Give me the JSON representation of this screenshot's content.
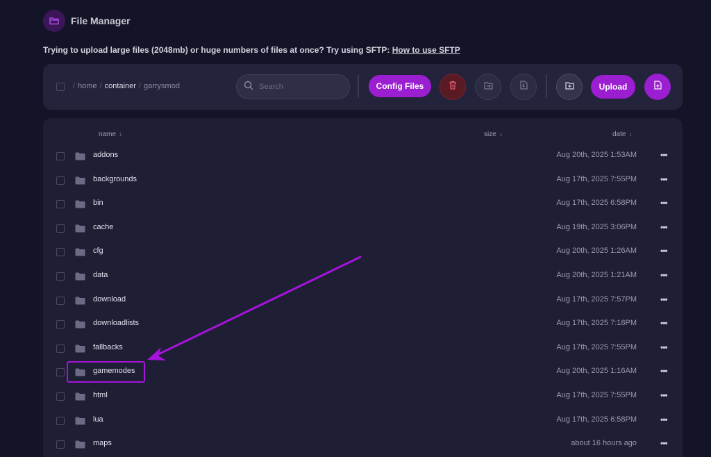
{
  "app": {
    "title": "File Manager"
  },
  "notice": {
    "text": "Trying to upload large files (2048mb) or huge numbers of files at once? Try using SFTP: ",
    "link_label": "How to use SFTP"
  },
  "breadcrumb": [
    "home",
    "container",
    "garrysmod"
  ],
  "search": {
    "placeholder": "Search"
  },
  "toolbar": {
    "config_label": "Config Files",
    "upload_label": "Upload"
  },
  "columns": {
    "name": "name",
    "size": "size",
    "date": "date",
    "sort_arrow": "↓"
  },
  "files": [
    {
      "name": "addons",
      "date": "Aug 20th, 2025 1:53AM"
    },
    {
      "name": "backgrounds",
      "date": "Aug 17th, 2025 7:55PM"
    },
    {
      "name": "bin",
      "date": "Aug 17th, 2025 6:58PM"
    },
    {
      "name": "cache",
      "date": "Aug 19th, 2025 3:06PM"
    },
    {
      "name": "cfg",
      "date": "Aug 20th, 2025 1:26AM"
    },
    {
      "name": "data",
      "date": "Aug 20th, 2025 1:21AM"
    },
    {
      "name": "download",
      "date": "Aug 17th, 2025 7:57PM"
    },
    {
      "name": "downloadlists",
      "date": "Aug 17th, 2025 7:18PM"
    },
    {
      "name": "fallbacks",
      "date": "Aug 17th, 2025 7:55PM"
    },
    {
      "name": "gamemodes",
      "date": "Aug 20th, 2025 1:16AM"
    },
    {
      "name": "html",
      "date": "Aug 17th, 2025 7:55PM"
    },
    {
      "name": "lua",
      "date": "Aug 17th, 2025 6:58PM"
    },
    {
      "name": "maps",
      "date": "about 16 hours ago"
    }
  ],
  "colors": {
    "accent": "#9b1ed1",
    "background": "#141428",
    "panel": "#23233c",
    "annotation": "#a514d8"
  }
}
